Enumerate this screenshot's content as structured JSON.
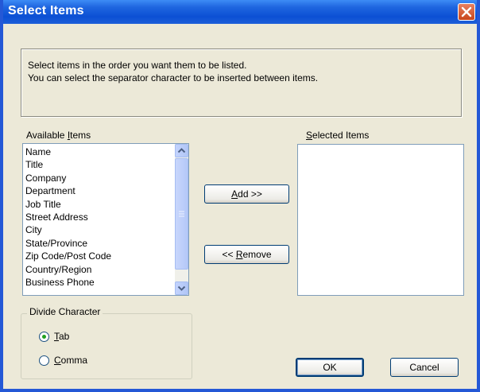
{
  "window": {
    "title": "Select Items"
  },
  "instructions": {
    "line1": "Select items in the order you want them to be listed.",
    "line2": "You can select the separator character to be inserted between items."
  },
  "available": {
    "label_prefix": "Available ",
    "label_accel": "I",
    "label_suffix": "tems",
    "items": [
      "Name",
      "Title",
      "Company",
      "Department",
      "Job Title",
      "Street Address",
      "City",
      "State/Province",
      "Zip Code/Post Code",
      "Country/Region",
      "Business Phone"
    ]
  },
  "selected": {
    "label_accel": "S",
    "label_suffix": "elected Items",
    "items": []
  },
  "buttons": {
    "add_accel": "A",
    "add_rest": "dd >>",
    "remove_prefix": "<< ",
    "remove_accel": "R",
    "remove_rest": "emove",
    "ok": "OK",
    "cancel": "Cancel"
  },
  "divide": {
    "label": "Divide Character",
    "tab_accel": "T",
    "tab_rest": "ab",
    "comma_accel": "C",
    "comma_rest": "omma",
    "selected": "Tab"
  },
  "icons": {
    "close": "close-icon",
    "scroll_up": "chevron-up-icon",
    "scroll_down": "chevron-down-icon",
    "grip": "scroll-grip-icon"
  },
  "colors": {
    "titlebar": "#0b4fd4",
    "face": "#ece9d8",
    "close": "#c8461c",
    "radio_dot": "#21a121"
  }
}
